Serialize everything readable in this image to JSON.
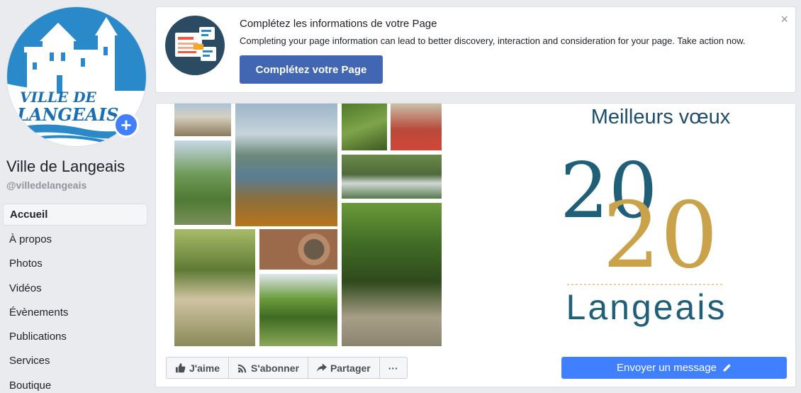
{
  "page": {
    "name": "Ville de Langeais",
    "handle": "@villedelangeais",
    "logo_text_line1": "VILLE DE",
    "logo_text_line2": "LANGEAIS"
  },
  "nav": {
    "items": [
      "Accueil",
      "À propos",
      "Photos",
      "Vidéos",
      "Évènements",
      "Publications",
      "Services",
      "Boutique"
    ]
  },
  "info_card": {
    "title": "Complétez les informations de votre Page",
    "description": "Completing your page information can lead to better discovery, interaction and consideration for your page. Take action now.",
    "button_label": "Complétez votre Page",
    "close_symbol": "×"
  },
  "cover": {
    "greeting": "Meilleurs vœux",
    "year_part1": "20",
    "year_part2": "20",
    "town": "Langeais",
    "colors": {
      "navy": "#1e4d6b",
      "gold": "#c9a24a",
      "teal": "#1f5f78"
    }
  },
  "actions": {
    "like": "J'aime",
    "subscribe": "S'abonner",
    "share": "Partager",
    "more": "···",
    "message": "Envoyer un message"
  },
  "colors": {
    "fb_blue": "#4267b2",
    "messenger_blue": "#4080ff",
    "bg": "#e9ebee"
  }
}
